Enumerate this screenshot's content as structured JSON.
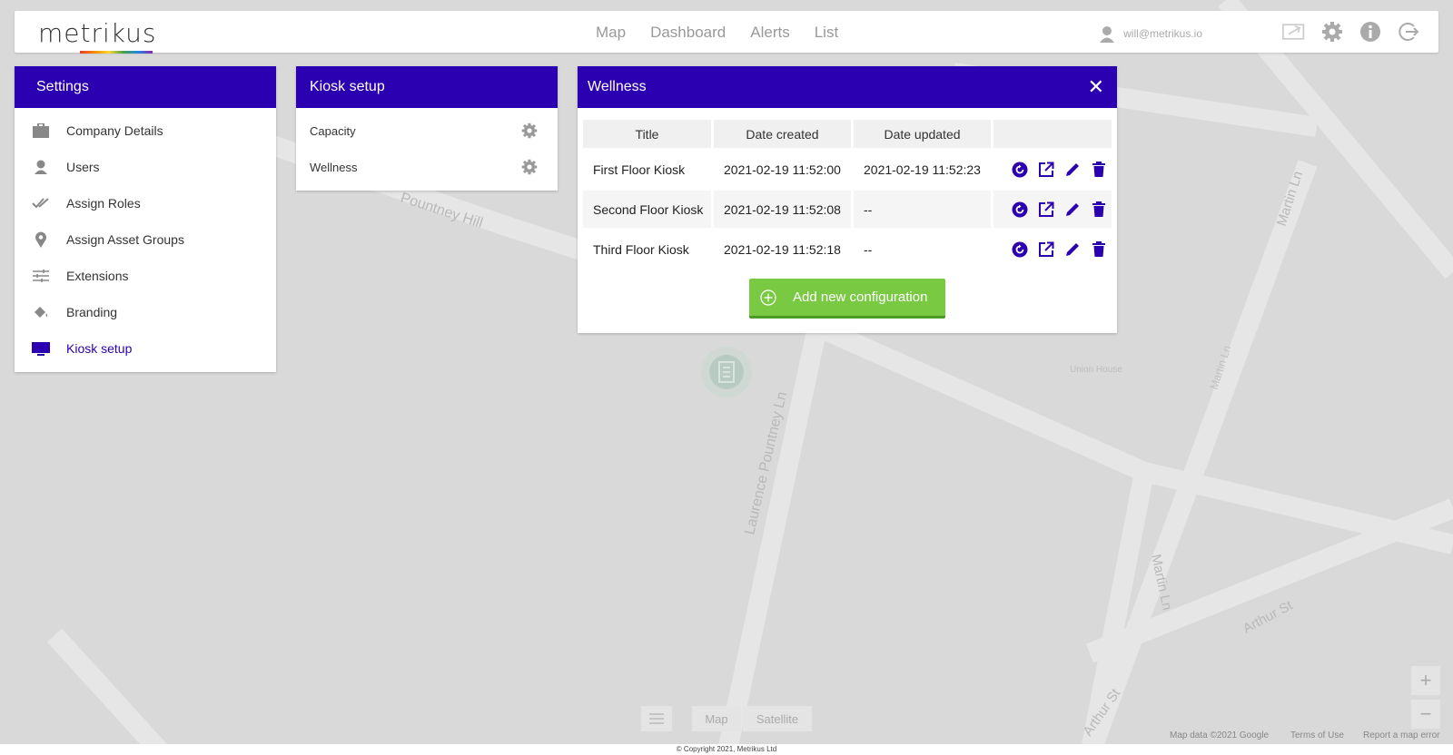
{
  "colors": {
    "primary": "#2b00b0",
    "accent_green": "#7ac943",
    "map_bg": "#d9d9d9"
  },
  "header": {
    "logo": "metrikus",
    "nav": [
      "Map",
      "Dashboard",
      "Alerts",
      "List"
    ],
    "user_email": "will@metrikus.io",
    "icons": [
      "share-icon",
      "gear-icon",
      "info-icon",
      "logout-icon"
    ]
  },
  "settings": {
    "title": "Settings",
    "items": [
      {
        "label": "Company Details",
        "icon": "briefcase-icon"
      },
      {
        "label": "Users",
        "icon": "user-icon"
      },
      {
        "label": "Assign Roles",
        "icon": "double-check-icon"
      },
      {
        "label": "Assign Asset Groups",
        "icon": "pin-icon"
      },
      {
        "label": "Extensions",
        "icon": "sliders-icon"
      },
      {
        "label": "Branding",
        "icon": "paint-bucket-icon"
      },
      {
        "label": "Kiosk setup",
        "icon": "monitor-icon"
      }
    ]
  },
  "kiosk": {
    "title": "Kiosk setup",
    "items": [
      {
        "label": "Capacity"
      },
      {
        "label": "Wellness"
      }
    ]
  },
  "wellness": {
    "title": "Wellness",
    "columns": [
      "Title",
      "Date created",
      "Date updated",
      ""
    ],
    "rows": [
      {
        "title": "First Floor Kiosk",
        "created": "2021-02-19 11:52:00",
        "updated": "2021-02-19 11:52:23"
      },
      {
        "title": "Second Floor Kiosk",
        "created": "2021-02-19 11:52:08",
        "updated": "--"
      },
      {
        "title": "Third Floor Kiosk",
        "created": "2021-02-19 11:52:18",
        "updated": "--"
      }
    ],
    "add_label": "Add new configuration"
  },
  "map": {
    "streets": [
      "Pountney Hill",
      "Laurence Pountney Ln",
      "Martin Ln",
      "Martin Ln",
      "Martin Ln",
      "Arthur St",
      "Arthur St",
      "Union House"
    ],
    "type_map": "Map",
    "type_satellite": "Satellite",
    "zoom_in": "+",
    "zoom_out": "−",
    "attribution": [
      "Map data ©2021 Google",
      "Terms of Use",
      "Report a map error"
    ]
  },
  "footer": {
    "copyright": "© Copyright 2021, Metrikus Ltd"
  }
}
